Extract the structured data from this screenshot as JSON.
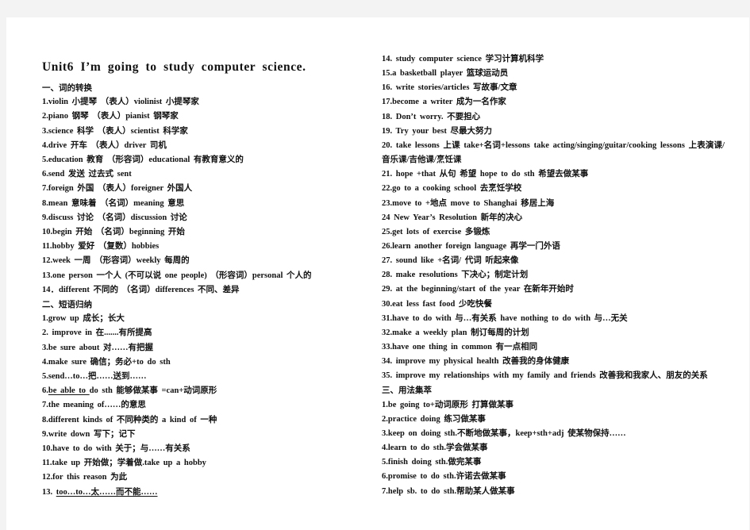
{
  "document": {
    "title": "Unit6  I’m  going  to  study  computer  science.",
    "left_column": [
      {
        "type": "heading",
        "text": "一、词的转换"
      },
      {
        "type": "item",
        "text": "1.violin 小提琴    （表人）violinist  小提琴家"
      },
      {
        "type": "item",
        "text": "2.piano 钢琴       （表人）pianist  钢琴家"
      },
      {
        "type": "item",
        "text": "3.science 科学     （表人）scientist 科学家"
      },
      {
        "type": "item",
        "text": "4.drive 开车        （表人）driver  司机"
      },
      {
        "type": "item",
        "text": "5.education 教育  （形容词）educational  有教育意义的"
      },
      {
        "type": "item",
        "text": "6.send 发送            过去式 sent"
      },
      {
        "type": "item",
        "text": "7.foreign 外国     （表人）foreigner 外国人"
      },
      {
        "type": "item",
        "text": "8.mean 意味着    （名词）meaning 意思"
      },
      {
        "type": "item",
        "text": "9.discuss 讨论     （名词）discussion 讨论"
      },
      {
        "type": "item",
        "text": "10.begin 开始      （名词）beginning 开始"
      },
      {
        "type": "item",
        "text": "11.hobby 爱好     （复数）hobbies"
      },
      {
        "type": "item",
        "text": "12.week 一周        （形容词）weekly 每周的"
      },
      {
        "type": "item",
        "text": "13.one  person 一个人 (不可以说 one  people)  （形容词）personal 个人的"
      },
      {
        "type": "item",
        "text": "14．different  不同的      （名词）differences 不同、差异"
      },
      {
        "type": "heading",
        "text": "二、短语归纳"
      },
      {
        "type": "item",
        "text": "1.grow  up 成长；长大"
      },
      {
        "type": "item",
        "text": "2. improve  in     在.......有所提高"
      },
      {
        "type": "item",
        "text": "3.be  sure  about 对……有把握"
      },
      {
        "type": "item",
        "text": "4.make  sure 确信；务必+to  do  sth"
      },
      {
        "type": "item",
        "text": "5.send…to…把……送到……"
      },
      {
        "type": "item_underlined",
        "prefix": "6.",
        "underlined": "be  able  to ",
        "rest": "do  sth   能够做某事    =can+动词原形"
      },
      {
        "type": "item",
        "text": "7.the  meaning  of……的意思"
      },
      {
        "type": "item",
        "text": "8.different  kinds  of 不同种类的      a  kind  of 一种"
      },
      {
        "type": "item",
        "text": "9.write  down 写下；记下"
      },
      {
        "type": "item",
        "text": "10.have  to  do  with 关于；与……有关系"
      },
      {
        "type": "item",
        "text": "11.take  up 开始做；学着做.take  up  a  hobby"
      },
      {
        "type": "item",
        "text": "12.for  this  reason   为此"
      },
      {
        "type": "item_underlined",
        "prefix": "13.  ",
        "underlined": "too…to…太……而不能……",
        "rest": ""
      }
    ],
    "right_column": [
      {
        "type": "item",
        "text": "14.  study  computer  science   学习计算机科学"
      },
      {
        "type": "item",
        "text": "15.a  basketball  player   篮球运动员"
      },
      {
        "type": "item",
        "text": "16.  write  stories/articles   写故事/文章"
      },
      {
        "type": "item",
        "text": "17.become  a  writer 成为一名作家"
      },
      {
        "type": "item",
        "text": "18.  Don’t  worry. 不要担心"
      },
      {
        "type": "item",
        "text": "19.  Try  your  best 尽最大努力"
      },
      {
        "type": "item_wrap",
        "text": "20.  take  lessons 上课    take+名词+lessons     take  acting/singing/guitar/cooking  lessons  上表演课/音乐课/吉他课/烹饪课"
      },
      {
        "type": "item",
        "text": "21.  hope  +that 从句  希望        hope  to  do  sth 希望去做某事"
      },
      {
        "type": "item",
        "text": "22.go  to  a  cooking  school 去烹饪学校"
      },
      {
        "type": "item",
        "text": "23.move  to  +地点        move  to  Shanghai 移居上海"
      },
      {
        "type": "item",
        "text": "24  New  Year’s  Resolution   新年的决心"
      },
      {
        "type": "item",
        "text": "25.get  lots  of  exercise   多锻炼"
      },
      {
        "type": "item",
        "text": "26.learn  another  foreign  language   再学一门外语"
      },
      {
        "type": "item",
        "text": "27.  sound  like  +名词/  代词    听起来像"
      },
      {
        "type": "item",
        "text": "28.  make  resolutions   下决心；制定计划"
      },
      {
        "type": "item",
        "text": "29.  at  the  beginning/start  of  the  year   在新年开始时"
      },
      {
        "type": "item",
        "text": "30.eat  less  fast  food   少吃快餐"
      },
      {
        "type": "item",
        "text": "31.have  to  do  with 与…有关系 have  nothing  to  do  with   与…无关"
      },
      {
        "type": "item",
        "text": "32.make  a  weekly  plan   制订每周的计划"
      },
      {
        "type": "item",
        "text": "33.have  one  thing  in  common   有一点相同"
      },
      {
        "type": "item",
        "text": "34.  improve  my  physical  health 改善我的身体健康"
      },
      {
        "type": "item",
        "text": "35.  improve  my  relationships  with  my  family  and  friends 改善我和我家人、朋友的关系"
      },
      {
        "type": "heading",
        "text": "三、用法集萃"
      },
      {
        "type": "item",
        "text": "1.be  going  to+动词原形    打算做某事"
      },
      {
        "type": "item",
        "text": "2.practice  doing 练习做某事"
      },
      {
        "type": "item",
        "text": "3.keep  on  doing  sth.不断地做某事，keep+sth+adj 使某物保持……"
      },
      {
        "type": "item",
        "text": "4.learn  to  do  sth.学会做某事"
      },
      {
        "type": "item",
        "text": "5.finish  doing  sth.做完某事"
      },
      {
        "type": "item",
        "text": "6.promise  to  do  sth.许诺去做某事"
      },
      {
        "type": "item",
        "text": "7.help  sb.  to  do  sth.帮助某人做某事"
      }
    ]
  }
}
